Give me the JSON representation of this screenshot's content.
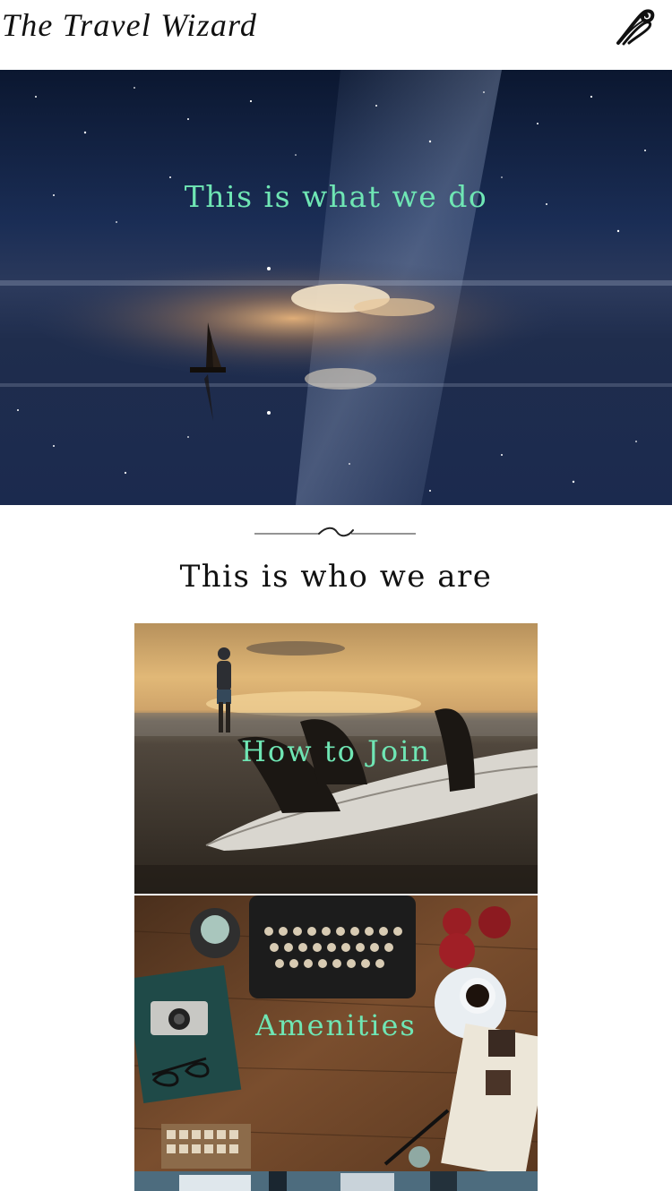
{
  "header": {
    "site_title": "The Travel Wizard",
    "menu_icon": "swirl-menu-icon"
  },
  "hero": {
    "heading": "This is what we do"
  },
  "section": {
    "title": "This is who we are",
    "divider_icon": "ornamental-divider"
  },
  "cards": [
    {
      "label": "How to Join"
    },
    {
      "label": "Amenities"
    },
    {
      "label": ""
    }
  ],
  "colors": {
    "accent": "#6fe6b4",
    "text": "#111111",
    "background": "#ffffff"
  }
}
